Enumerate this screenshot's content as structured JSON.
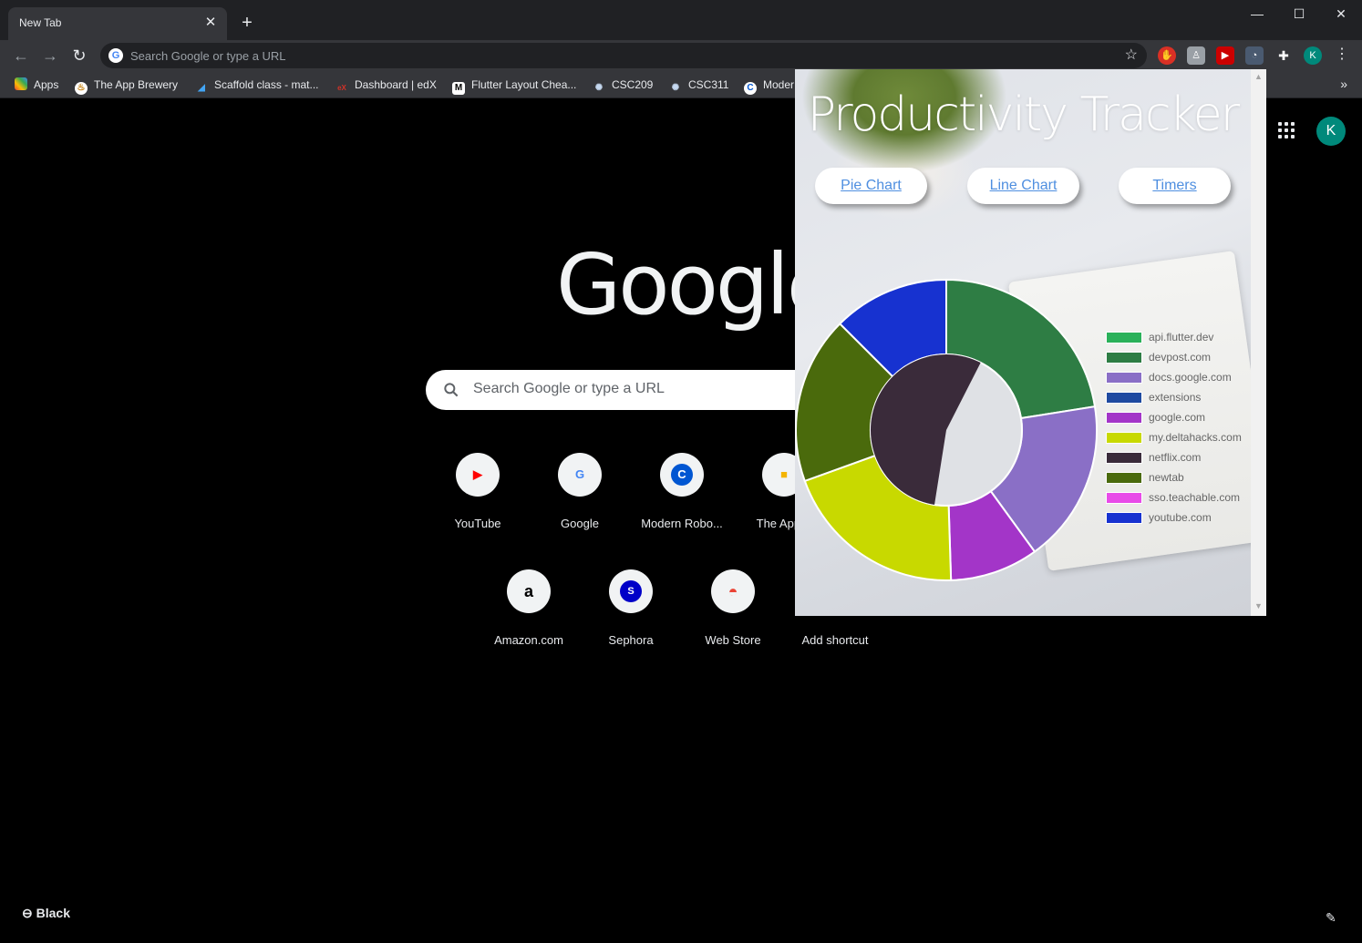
{
  "browser": {
    "tab_title": "New Tab",
    "tab_close": "✕",
    "new_tab": "+",
    "window_controls": {
      "minimize": "—",
      "maximize": "☐",
      "close": "✕"
    },
    "nav": {
      "back": "←",
      "forward": "→",
      "reload": "↻"
    },
    "omnibox_placeholder": "Search Google or type a URL",
    "profile_initial": "K",
    "bookmarks": [
      {
        "label": "Apps",
        "icon": "apps-grid-icon"
      },
      {
        "label": "The App Brewery",
        "icon": "app-brewery-icon"
      },
      {
        "label": "Scaffold class - mat...",
        "icon": "flutter-icon"
      },
      {
        "label": "Dashboard | edX",
        "icon": "edx-icon"
      },
      {
        "label": "Flutter Layout Chea...",
        "icon": "medium-icon"
      },
      {
        "label": "CSC209",
        "icon": "uoft-icon"
      },
      {
        "label": "CSC311",
        "icon": "uoft-icon"
      },
      {
        "label": "Moder",
        "icon": "coursera-icon"
      }
    ],
    "bookmarks_more": "»"
  },
  "ntp": {
    "logo": "Google",
    "search_placeholder": "Search Google or type a URL",
    "profile_initial": "K",
    "shortcuts": [
      {
        "label": "YouTube",
        "glyph": "▶",
        "color": "#ff0000"
      },
      {
        "label": "Google",
        "glyph": "G",
        "color": "#4285f4"
      },
      {
        "label": "Modern Robo...",
        "glyph": "C",
        "color": "#0056d2"
      },
      {
        "label": "The App B",
        "glyph": "■",
        "color": "#f4b400"
      },
      {
        "label": "Amazon.com",
        "glyph": "a",
        "color": "#000000"
      },
      {
        "label": "Sephora",
        "glyph": "S",
        "color": "#0000c8"
      },
      {
        "label": "Web Store",
        "glyph": "◓",
        "color": "#ea4335"
      },
      {
        "label": "Add shortcut",
        "glyph": "",
        "color": "#000000"
      }
    ],
    "customize_label": "Black"
  },
  "popup": {
    "title": "Productivity Tracker",
    "buttons": [
      "Pie Chart",
      "Line Chart",
      "Timers"
    ]
  },
  "chart_data": {
    "type": "pie",
    "donut": true,
    "categories": [
      "api.flutter.dev",
      "devpost.com",
      "docs.google.com",
      "extensions",
      "google.com",
      "my.deltahacks.com",
      "netflix.com",
      "newtab",
      "sso.teachable.com",
      "youtube.com"
    ],
    "values": [
      0,
      22.5,
      17.5,
      0,
      9.5,
      20,
      0,
      18,
      0,
      12.5
    ],
    "inner_values": [
      0,
      0,
      0,
      0,
      0,
      0,
      55,
      0,
      0,
      0
    ],
    "colors": [
      "#2bb15a",
      "#2e7d44",
      "#8a6fc6",
      "#1f4aa0",
      "#a335c8",
      "#c8d900",
      "#3a2b3a",
      "#4a6a0c",
      "#e84be8",
      "#1732d0"
    ],
    "legend": "right"
  }
}
